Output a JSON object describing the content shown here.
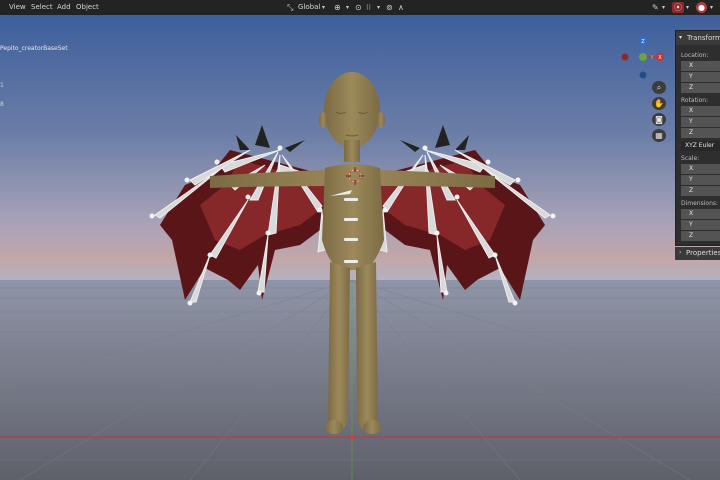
{
  "menu": {
    "view": "View",
    "select": "Select",
    "add": "Add",
    "object": "Object"
  },
  "toolbar": {
    "orientation": "Global",
    "snap_glyph": "⊙",
    "grid_glyph": "⁝⁝",
    "falloff_glyph": "∧"
  },
  "scene": {
    "object_name": "Pepito_creatorBaseSet",
    "side_num_1": "1",
    "side_num_2": "8"
  },
  "gizmo": {
    "z": "Z",
    "y": "Y",
    "x": "X"
  },
  "transform": {
    "header": "Transform",
    "location_label": "Location:",
    "rotation_label": "Rotation:",
    "rotation_mode": "XYZ Euler",
    "scale_label": "Scale:",
    "dimensions_label": "Dimensions:",
    "x": "X",
    "y": "Y",
    "z": "Z"
  },
  "properties": {
    "header": "Properties"
  },
  "colors": {
    "header_bg": "#232323",
    "panel_bg": "#2e2e2e",
    "field_bg": "#545454",
    "red_axis": "#c0363a",
    "green_axis": "#6aa43b",
    "blue_axis": "#2c6fd0"
  }
}
